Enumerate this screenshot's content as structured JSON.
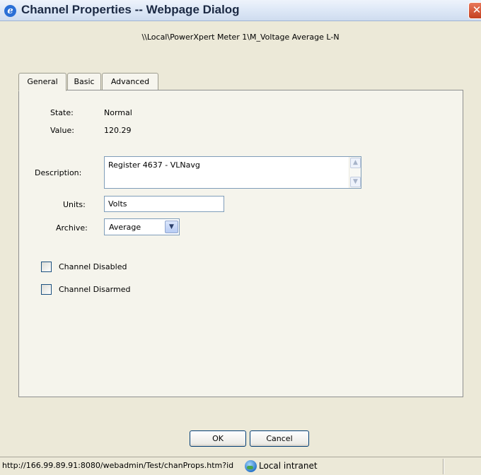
{
  "window": {
    "title": "Channel Properties -- Webpage Dialog",
    "close_glyph": "✕"
  },
  "path": "\\\\Local\\PowerXpert Meter 1\\M_Voltage Average L-N",
  "tabs": [
    {
      "label": "General",
      "active": true
    },
    {
      "label": "Basic",
      "active": false
    },
    {
      "label": "Advanced",
      "active": false
    }
  ],
  "general": {
    "state_label": "State:",
    "state_value": "Normal",
    "value_label": "Value:",
    "value_value": "120.29",
    "description_label": "Description:",
    "description_value": "Register 4637 - VLNavg",
    "units_label": "Units:",
    "units_value": "Volts",
    "archive_label": "Archive:",
    "archive_value": "Average",
    "channel_disabled_label": "Channel Disabled",
    "channel_disabled_checked": false,
    "channel_disarmed_label": "Channel Disarmed",
    "channel_disarmed_checked": false
  },
  "buttons": {
    "ok": "OK",
    "cancel": "Cancel"
  },
  "statusbar": {
    "url": "http://166.99.89.91:8080/webadmin/Test/chanProps.htm?id",
    "zone": "Local intranet"
  }
}
